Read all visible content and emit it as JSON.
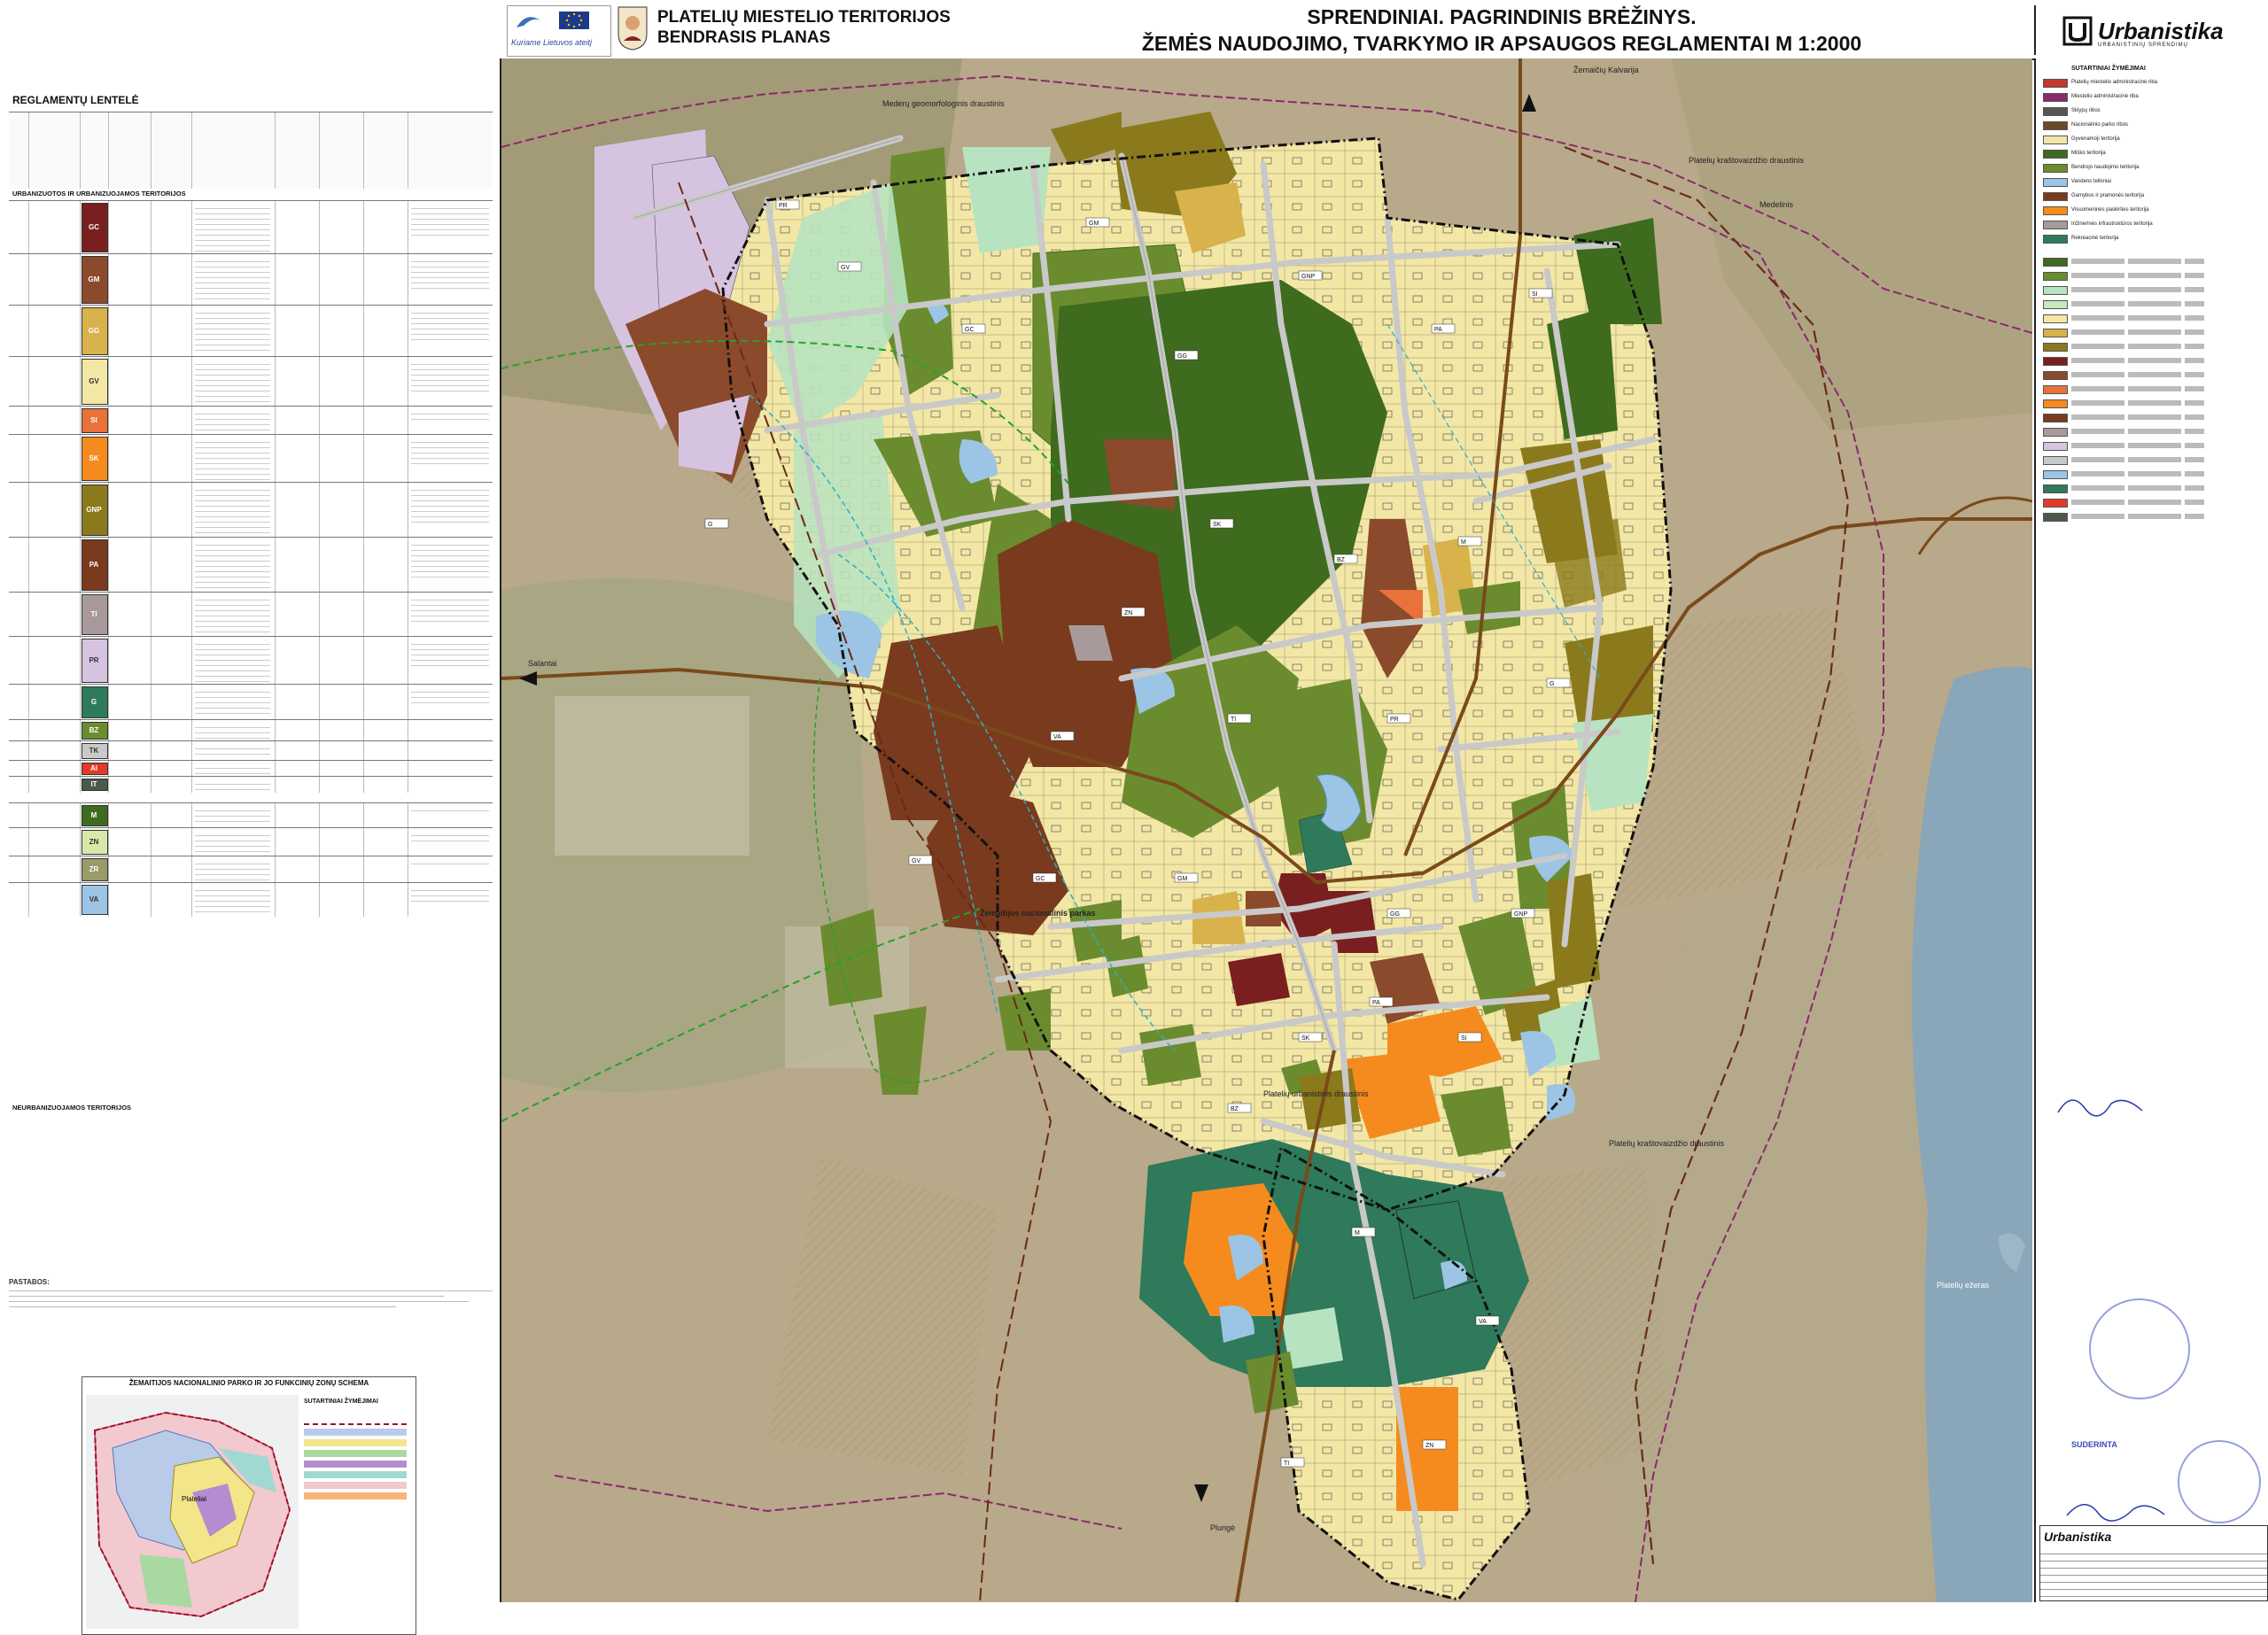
{
  "header": {
    "project_line1": "PLATELIŲ MIESTELIO TERITORIJOS",
    "project_line2": "BENDRASIS PLANAS",
    "title_line1": "SPRENDINIAI. PAGRINDINIS BRĖŽINYS.",
    "title_line2": "ŽEMĖS NAUDOJIMO, TVARKYMO IR APSAUGOS REGLAMENTAI  M 1:2000",
    "funding_logo": "Kuriame Lietuvos ateitį",
    "brand": "Urbanistika",
    "brand_sub": "URBANISTINIŲ SPRENDIMŲ"
  },
  "left_panel": {
    "title": "REGLAMENTŲ LENTELĖ",
    "section_urban": "URBANIZUOTOS IR URBANIZUOJAMOS TERITORIJOS",
    "section_nonurban": "NEURBANIZUOJAMOS TERITORIJOS",
    "rows": [
      {
        "code": "GC",
        "color": "#7a1f1f"
      },
      {
        "code": "GM",
        "color": "#8b4a2b"
      },
      {
        "code": "GG",
        "color": "#d8b24a"
      },
      {
        "code": "GV",
        "color": "#f3e7a6"
      },
      {
        "code": "SI",
        "color": "#e8723a"
      },
      {
        "code": "SK",
        "color": "#f58b1f"
      },
      {
        "code": "GNP",
        "color": "#8a7a1c"
      },
      {
        "code": "PA",
        "color": "#7a3a1d"
      },
      {
        "code": "TI",
        "color": "#a89a9a"
      },
      {
        "code": "PR",
        "color": "#d6c3e0"
      },
      {
        "code": "G",
        "color": "#2e7a5a"
      },
      {
        "code": "BZ",
        "color": "#6a8c2e"
      },
      {
        "code": "TK",
        "color": "#c9c9c9"
      },
      {
        "code": "AI",
        "color": "#e23a2a"
      },
      {
        "code": "IT",
        "color": "#4a5a4a"
      },
      {
        "code": "M",
        "color": "#3f6b1e"
      },
      {
        "code": "ZN",
        "color": "#d8e8a8"
      },
      {
        "code": "ZR",
        "color": "#9a9a6a"
      },
      {
        "code": "VA",
        "color": "#9cc4e4"
      }
    ],
    "notes_title": "PASTABOS:",
    "inset_title": "ŽEMAITIJOS NACIONALINIO PARKO IR JO FUNKCINIŲ ZONŲ SCHEMA",
    "inset_legend_title": "SUTARTINIAI ŽYMĖJIMAI",
    "inset_place": "Plateliai"
  },
  "map": {
    "labels": {
      "north": "Žemaičių Kalvarija",
      "west_road": "Salantai",
      "south_road": "Plungė",
      "park": "Žemaitijos nacionalinis parkas",
      "reserve": "Platelių urbanistinis draustinis",
      "landscape": "Platelių kraštovaizdžio draustinis",
      "geomorph": "Mederų geomorfologinis draustinis",
      "lake": "Platelių ežeras",
      "meadow": "Medelinis"
    },
    "zones": [
      "GV",
      "GC",
      "GM",
      "GG",
      "GNP",
      "PA",
      "SI",
      "SK",
      "BZ",
      "M",
      "ZN",
      "VA",
      "TI",
      "PR",
      "G"
    ]
  },
  "legend": {
    "title": "SUTARTINIAI ŽYMĖJIMAI",
    "items": [
      {
        "label": "Platelių miestelio administracinė riba",
        "color": "#c0392b"
      },
      {
        "label": "Miestelio administracinė riba",
        "color": "#8a2a6a"
      },
      {
        "label": "Sklypų ribos",
        "color": "#555555"
      },
      {
        "label": "Nacionalinio parko ribos",
        "color": "#6a4a2a"
      },
      {
        "label": "Gyvenamoji teritorija",
        "color": "#f3e7a6"
      },
      {
        "label": "Miško teritorija",
        "color": "#3f6b1e"
      },
      {
        "label": "Bendrojo naudojimo teritorija",
        "color": "#6a8c2e"
      },
      {
        "label": "Vandens telkiniai",
        "color": "#9cc4e4"
      },
      {
        "label": "Gamybos ir pramonės teritorija",
        "color": "#7a3a1d"
      },
      {
        "label": "Visuomeninės paskirties teritorija",
        "color": "#f58b1f"
      },
      {
        "label": "Inžinerinės infrastruktūros teritorija",
        "color": "#a89a9a"
      },
      {
        "label": "Rekreacinė teritorija",
        "color": "#2e7a5a"
      }
    ],
    "stamp_text": "SUDERINTA",
    "brand": "Urbanistika"
  }
}
